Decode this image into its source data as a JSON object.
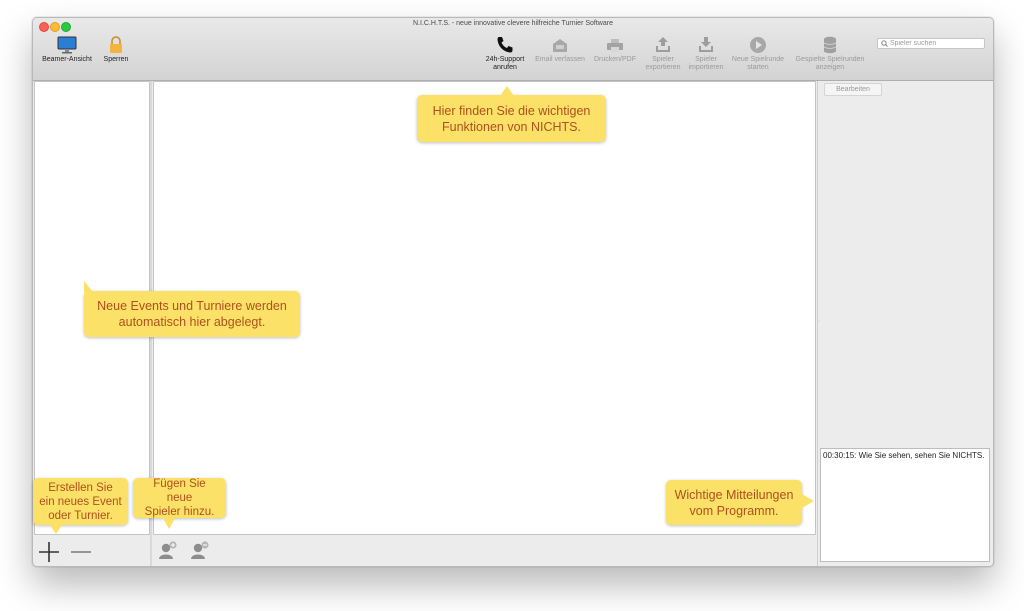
{
  "window": {
    "title": "N.I.C.H.T.S. - neue innovative clevere hilfreiche Turnier Software"
  },
  "toolbar": {
    "beamer": "Beamer-Ansicht",
    "lock": "Sperren",
    "support": "24h-Support\nanrufen",
    "email": "Email verfassen",
    "print": "Drucken/PDF",
    "export": "Spieler\nexportieren",
    "import": "Spieler\nimportieren",
    "new_round": "Neue Spielrunde\nstarten",
    "played_rounds": "Gespielte Spielrunden\nanzeigen"
  },
  "search": {
    "placeholder": "Spieler suchen"
  },
  "right_panel": {
    "edit_button": "Bearbeiten",
    "log_message": "00:30:15: Wie Sie sehen, sehen Sie NICHTS."
  },
  "tooltips": {
    "toolbar_hint": "Hier finden Sie die wichtigen\nFunktionen von NICHTS.",
    "events_hint": "Neue Events und Turniere werden\nautomatisch hier abgelegt.",
    "create_hint": "Erstellen Sie\nein neues Event\noder Turnier.",
    "players_hint": "Fügen Sie neue\nSpieler hinzu.",
    "messages_hint": "Wichtige Mitteilungen\nvom Programm."
  },
  "colors": {
    "tooltip_bg": "#fbe168",
    "tooltip_text": "#b0501d",
    "monitor_blue": "#2a7fd5",
    "lock_orange": "#f3b33d"
  }
}
